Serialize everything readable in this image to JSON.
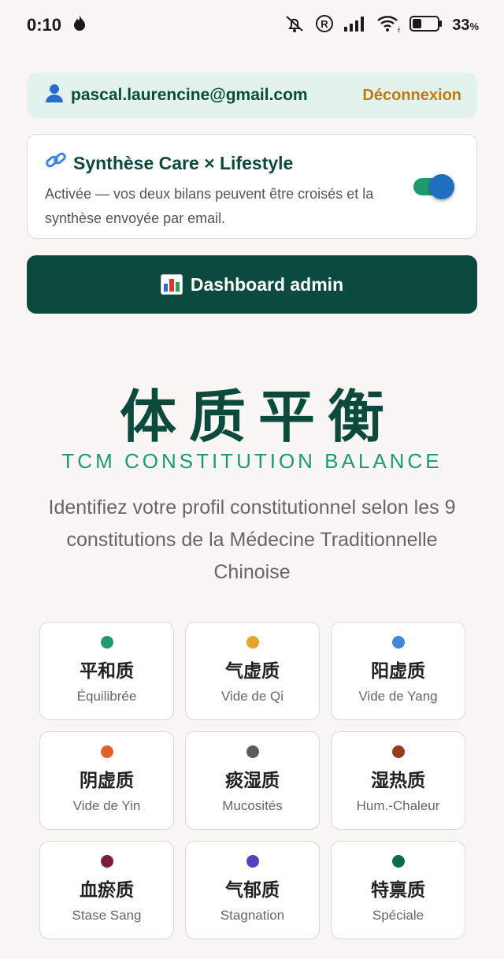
{
  "status_bar": {
    "time": "0:10",
    "battery": "33",
    "battery_unit": "%"
  },
  "user_bar": {
    "email": "pascal.laurencine@gmail.com",
    "logout_label": "Déconnexion"
  },
  "synthesis": {
    "title": "Synthèse Care × Lifestyle",
    "description": "Activée — vos deux bilans peuvent être croisés et la synthèse envoyée par email.",
    "enabled": true
  },
  "admin_button": {
    "label": "Dashboard admin"
  },
  "hero": {
    "title": "体质平衡",
    "subtitle": "TCM CONSTITUTION BALANCE",
    "description": "Identifiez votre profil constitutionnel selon les 9 constitutions de la Médecine Traditionnelle Chinoise"
  },
  "constitutions": [
    {
      "cn": "平和质",
      "fr": "Équilibrée",
      "color": "#1f9a6e"
    },
    {
      "cn": "气虚质",
      "fr": "Vide de Qi",
      "color": "#e8a22a"
    },
    {
      "cn": "阳虚质",
      "fr": "Vide de Yang",
      "color": "#3d88d8"
    },
    {
      "cn": "阴虚质",
      "fr": "Vide de Yin",
      "color": "#e0612e"
    },
    {
      "cn": "痰湿质",
      "fr": "Mucosités",
      "color": "#5d5d5d"
    },
    {
      "cn": "湿热质",
      "fr": "Hum.-Chaleur",
      "color": "#9a3a1e"
    },
    {
      "cn": "血瘀质",
      "fr": "Stase Sang",
      "color": "#7a1e3a"
    },
    {
      "cn": "气郁质",
      "fr": "Stagnation",
      "color": "#5b3fbf"
    },
    {
      "cn": "特禀质",
      "fr": "Spéciale",
      "color": "#0e6a4e"
    }
  ],
  "colors": {
    "primary": "#0b4a3c",
    "accent": "#1f9a6e",
    "logout": "#c07a12",
    "toggle_thumb": "#1f70c1"
  }
}
